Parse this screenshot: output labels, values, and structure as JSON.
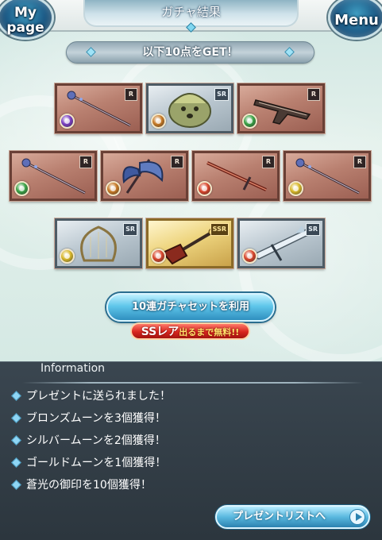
{
  "header": {
    "title": "ガチャ結果",
    "mypage_line1": "My",
    "mypage_line2": "page",
    "menu_label": "Menu"
  },
  "banner": {
    "text": "以下10点をGET！"
  },
  "items": [
    {
      "rarity": "R",
      "element": "dark",
      "element_color": "#7a3fc2",
      "art": "staff"
    },
    {
      "rarity": "SR",
      "element": "earth",
      "element_color": "#c77a26",
      "art": "creature"
    },
    {
      "rarity": "R",
      "element": "wind",
      "element_color": "#3aa246",
      "art": "gun"
    },
    {
      "rarity": "R",
      "element": "wind",
      "element_color": "#3aa246",
      "art": "staff"
    },
    {
      "rarity": "R",
      "element": "earth",
      "element_color": "#c77a26",
      "art": "axe"
    },
    {
      "rarity": "R",
      "element": "fire",
      "element_color": "#d8462c",
      "art": "sword"
    },
    {
      "rarity": "R",
      "element": "light",
      "element_color": "#d8b82a",
      "art": "staff"
    },
    {
      "rarity": "SR",
      "element": "light",
      "element_color": "#d8b82a",
      "art": "harp"
    },
    {
      "rarity": "SSR",
      "element": "fire",
      "element_color": "#d8462c",
      "art": "guitar"
    },
    {
      "rarity": "SR",
      "element": "fire",
      "element_color": "#d8462c",
      "art": "blade"
    }
  ],
  "gacha_button": {
    "label": "10連ガチャセットを利用"
  },
  "free_badge": {
    "ss_text": "SSレア",
    "rest_text": "出るまで無料!!"
  },
  "information": {
    "title": "Information",
    "messages": [
      "プレゼントに送られました！",
      "ブロンズムーンを3個獲得！",
      "シルバームーンを2個獲得！",
      "ゴールドムーンを1個獲得！",
      "蒼光の御印を10個獲得！"
    ]
  },
  "present_button": {
    "label": "プレゼントリストへ"
  }
}
